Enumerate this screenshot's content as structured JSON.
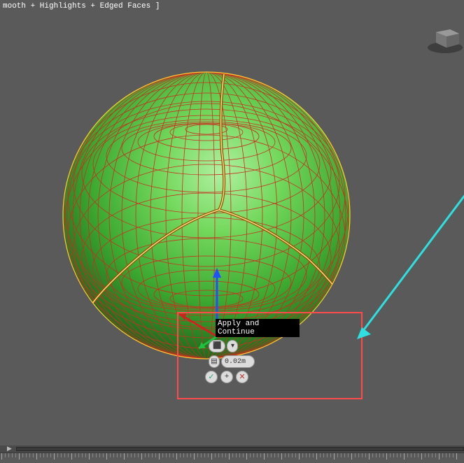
{
  "viewport": {
    "label": "mooth + Highlights + Edged Faces ]"
  },
  "caddy": {
    "tooltip": "Apply and Continue",
    "spinner_value": "0.02m",
    "icons": {
      "type_selector": "⬛",
      "spinner": "▤",
      "dropdown": "▾",
      "ok": "✓",
      "apply": "+",
      "cancel": "✕"
    }
  }
}
